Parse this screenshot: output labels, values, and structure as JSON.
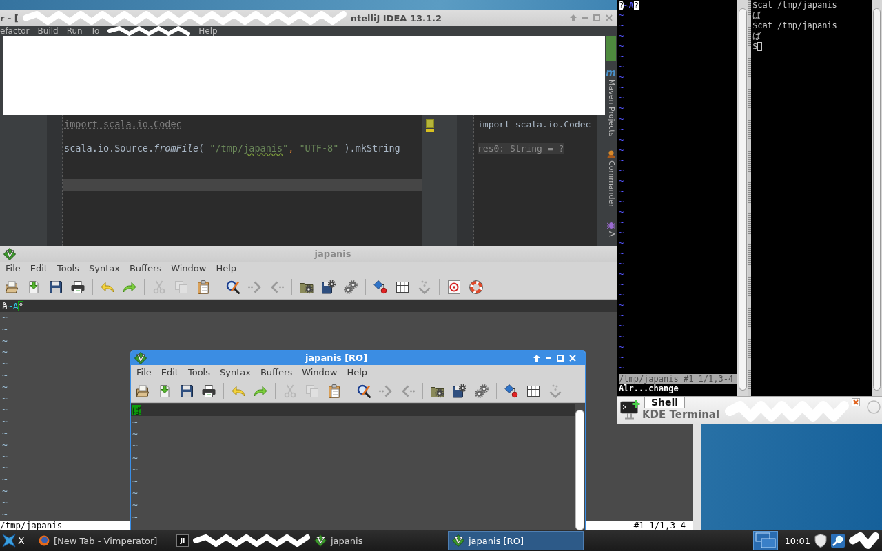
{
  "ide": {
    "title_start": "r - [",
    "title_end": "ntelliJ IDEA 13.1.2",
    "menu": [
      "efactor",
      "Build",
      "Run",
      "To",
      "Help"
    ],
    "editor": {
      "lines": [
        {
          "tokens": [
            {
              "text": "import scala.io.Codec",
              "kind": "unused"
            }
          ],
          "output": {
            "text": "import scala.io.Codec",
            "kind": "echo"
          },
          "current": false
        },
        {
          "current": false
        },
        {
          "tokens": [
            {
              "text": "scala.io.Source.",
              "kind": "plain"
            },
            {
              "text": "fromFile",
              "kind": "method"
            },
            {
              "text": "( ",
              "kind": "plain"
            },
            {
              "text": "\"/tmp/",
              "kind": "string"
            },
            {
              "text": "japanis",
              "kind": "typo"
            },
            {
              "text": "\"",
              "kind": "string"
            },
            {
              "text": ", ",
              "kind": "comma"
            },
            {
              "text": "\"UTF-8\"",
              "kind": "string"
            },
            {
              "text": " ).mkString",
              "kind": "plain"
            }
          ],
          "output": {
            "text": "res0: String = ?",
            "kind": "result"
          },
          "current": false
        },
        {
          "current": false
        },
        {
          "current": false
        },
        {
          "current": true
        }
      ]
    },
    "tool_windows": [
      {
        "kind": "letter",
        "icon_text": "m",
        "label": "Maven Projects"
      },
      {
        "kind": "figure",
        "label": "Commander"
      },
      {
        "kind": "bug",
        "label": "A"
      }
    ]
  },
  "vim_main": {
    "title": "japanis",
    "menu": [
      "File",
      "Edit",
      "Tools",
      "Syntax",
      "Buffers",
      "Window",
      "Help"
    ],
    "toolbar": [
      [
        {
          "kind": "folder",
          "disabled": false
        },
        {
          "kind": "download",
          "disabled": false
        },
        {
          "kind": "floppy",
          "disabled": false
        },
        {
          "kind": "printer",
          "disabled": false
        }
      ],
      [
        {
          "kind": "undo",
          "disabled": false
        },
        {
          "kind": "redo",
          "disabled": false
        }
      ],
      [
        {
          "kind": "scissors",
          "disabled": true
        },
        {
          "kind": "pages",
          "disabled": true
        },
        {
          "kind": "clipboard",
          "disabled": false
        }
      ],
      [
        {
          "kind": "magnifier",
          "disabled": false
        },
        {
          "kind": "forward",
          "disabled": false
        },
        {
          "kind": "backward",
          "disabled": false
        }
      ],
      [
        {
          "kind": "foldergear",
          "disabled": false
        },
        {
          "kind": "floppygear",
          "disabled": false
        },
        {
          "kind": "gears",
          "disabled": false
        }
      ],
      [
        {
          "kind": "diamond",
          "disabled": false
        },
        {
          "kind": "grid",
          "disabled": false
        },
        {
          "kind": "dropdown",
          "disabled": false
        }
      ],
      [
        {
          "kind": "helpdoc",
          "disabled": false
        },
        {
          "kind": "lifebuoy",
          "disabled": false
        }
      ]
    ],
    "first_line": [
      {
        "text": "ã",
        "kind": "plain"
      },
      {
        "text": "~A",
        "kind": "special"
      },
      {
        "text": "°",
        "kind": "hollowcursor"
      }
    ],
    "tildes": [
      "~",
      "~",
      "~",
      "~",
      "~",
      "~",
      "~",
      "~",
      "~",
      "~",
      "~",
      "~",
      "~",
      "~",
      "~",
      "~",
      "~",
      "~"
    ],
    "status": "/tmp/japanis",
    "ruler": "#1 1/1,3-4"
  },
  "terminal": {
    "left_pane": {
      "first_line": [
        {
          "text": "?",
          "kind": "replacement"
        },
        {
          "text": "~A",
          "kind": "special"
        },
        {
          "text": "?",
          "kind": "cursor"
        }
      ],
      "tildes": [
        "~",
        "~",
        "~",
        "~",
        "~",
        "~",
        "~",
        "~",
        "~",
        "~",
        "~",
        "~",
        "~",
        "~",
        "~",
        "~",
        "~",
        "~",
        "~",
        "~",
        "~",
        "~",
        "~",
        "~",
        "~",
        "~",
        "~",
        "~",
        "~",
        "~",
        "~",
        "~",
        "~",
        "~",
        "~"
      ],
      "status": "/tmp/japanis #1 1/1,3-4",
      "message": "Alr...change"
    },
    "right_pane": {
      "lines": [
        "$cat /tmp/japanis",
        "ば",
        "$cat /tmp/japanis",
        "ば",
        "$"
      ]
    },
    "tabs": [
      {
        "label": "Shell",
        "selected": true
      }
    ],
    "title": "KDE Terminal"
  },
  "vim_ro": {
    "title": "japanis [RO]",
    "menu": [
      "File",
      "Edit",
      "Tools",
      "Syntax",
      "Buffers",
      "Window",
      "Help"
    ],
    "toolbar": [
      [
        {
          "kind": "folder",
          "disabled": false
        },
        {
          "kind": "download",
          "disabled": false
        },
        {
          "kind": "floppy",
          "disabled": false
        },
        {
          "kind": "printer",
          "disabled": false
        }
      ],
      [
        {
          "kind": "undo",
          "disabled": false
        },
        {
          "kind": "redo",
          "disabled": false
        }
      ],
      [
        {
          "kind": "scissors",
          "disabled": true
        },
        {
          "kind": "pages",
          "disabled": true
        },
        {
          "kind": "clipboard",
          "disabled": false
        }
      ],
      [
        {
          "kind": "magnifier",
          "disabled": false
        },
        {
          "kind": "forward",
          "disabled": false
        },
        {
          "kind": "backward",
          "disabled": false
        }
      ],
      [
        {
          "kind": "foldergear",
          "disabled": false
        },
        {
          "kind": "floppygear",
          "disabled": false
        },
        {
          "kind": "gears",
          "disabled": false
        }
      ],
      [
        {
          "kind": "diamond",
          "disabled": false
        },
        {
          "kind": "grid",
          "disabled": false
        },
        {
          "kind": "dropdown",
          "disabled": false
        }
      ]
    ],
    "first_line": [
      {
        "text": "ば",
        "kind": "cursor"
      }
    ],
    "tildes": [
      "~",
      "~",
      "~",
      "~",
      "~",
      "~",
      "~",
      "~",
      "~"
    ]
  },
  "taskbar": {
    "start_label": "X",
    "tasks": [
      {
        "kind": "browser",
        "label": "[New Tab - Vimperator]",
        "selected": false
      },
      {
        "kind": "ide",
        "logo": "JI",
        "selected": false
      },
      {
        "kind": "vim",
        "label": "japanis",
        "selected": false
      },
      {
        "kind": "vim",
        "label": "japanis [RO]",
        "selected": true
      }
    ],
    "clock": "10:01"
  }
}
